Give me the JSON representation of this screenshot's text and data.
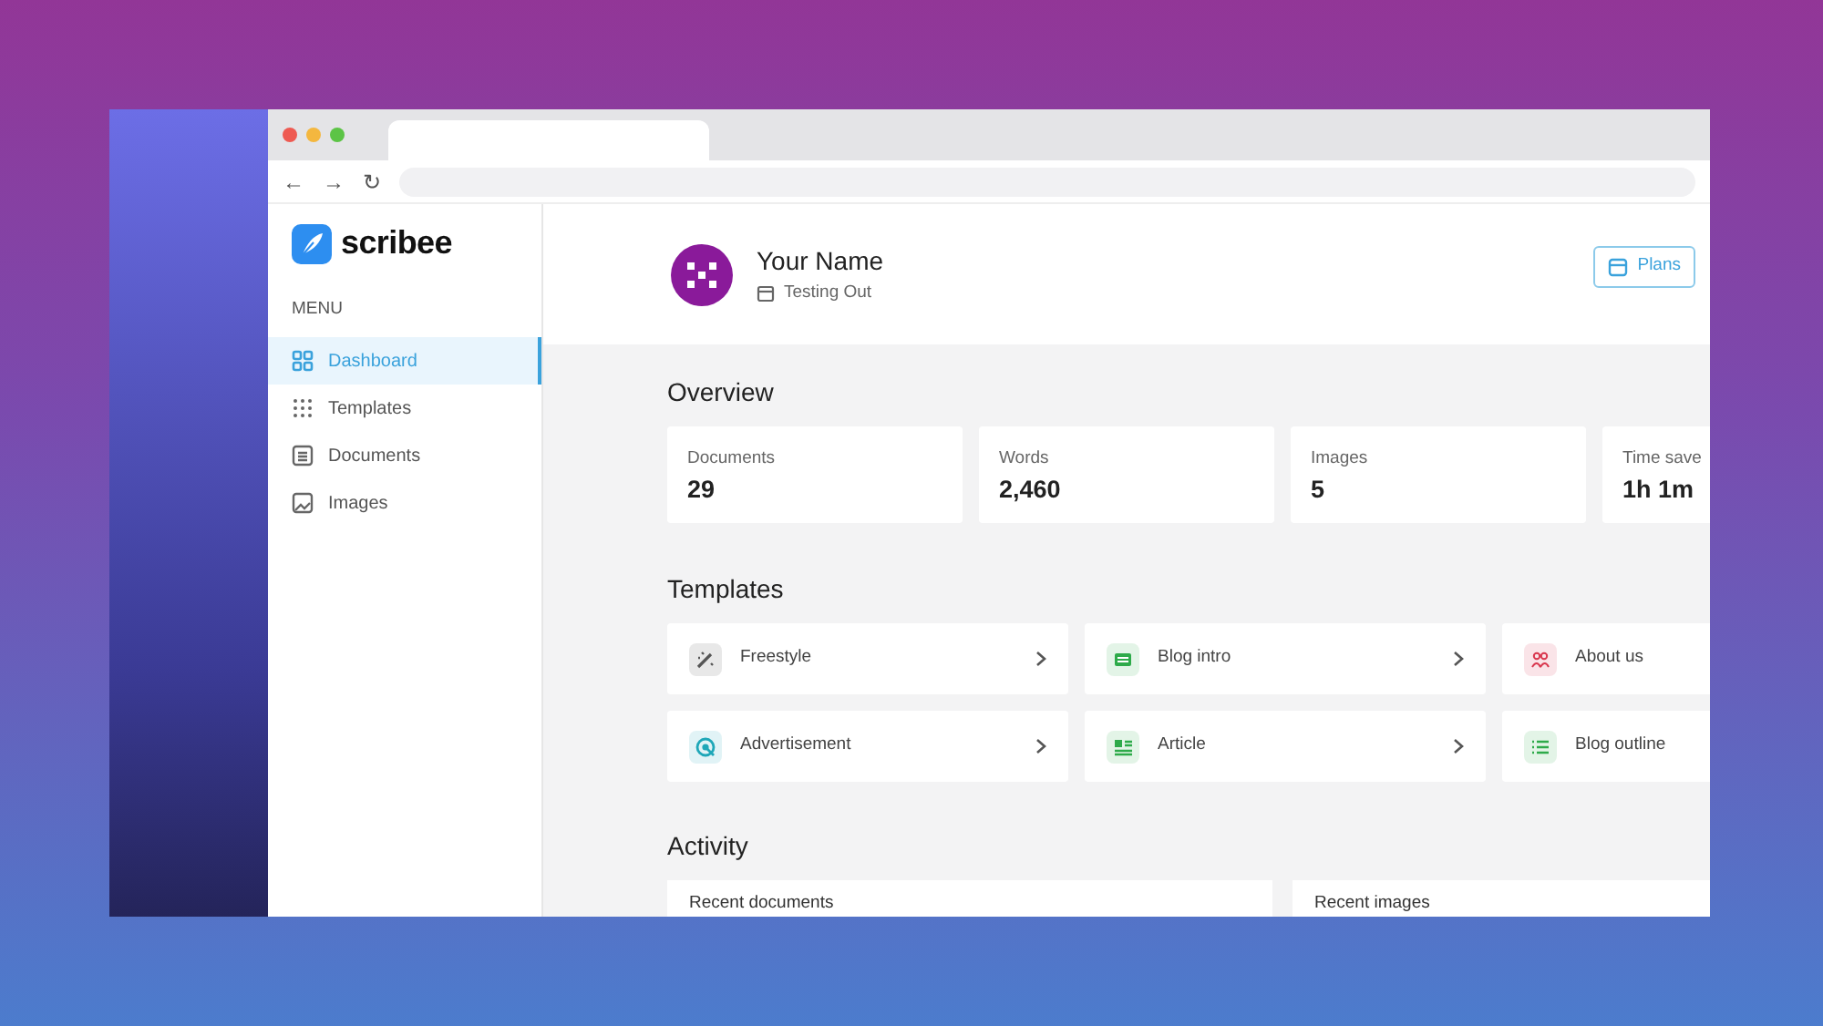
{
  "browser": {
    "nav_buttons": [
      "←",
      "→",
      "↻"
    ]
  },
  "sidebar": {
    "logo": "scribee",
    "menu_label": "MENU",
    "items": [
      {
        "label": "Dashboard",
        "kind": "grid4",
        "selected": true
      },
      {
        "label": "Templates",
        "kind": "grid9",
        "selected": false
      },
      {
        "label": "Documents",
        "kind": "doc",
        "selected": false
      },
      {
        "label": "Images",
        "kind": "image",
        "selected": false
      }
    ]
  },
  "header": {
    "name": "Your Name",
    "subtitle": "Testing Out",
    "plans_button": "Plans"
  },
  "overview": {
    "title": "Overview",
    "stats": [
      {
        "label": "Documents",
        "value": "29"
      },
      {
        "label": "Words",
        "value": "2,460"
      },
      {
        "label": "Images",
        "value": "5"
      },
      {
        "label": "Time save",
        "value": "1h 1m"
      }
    ]
  },
  "templates": {
    "title": "Templates",
    "items": [
      {
        "label": "Freestyle",
        "kind": "wand",
        "color": "#555555",
        "chevron": true
      },
      {
        "label": "Blog intro",
        "kind": "card",
        "color": "#2eaa4a",
        "chevron": true
      },
      {
        "label": "About us",
        "kind": "people",
        "color": "#d9384f",
        "chevron": false
      },
      {
        "label": "Advertisement",
        "kind": "target",
        "color": "#1fa7b8",
        "chevron": true
      },
      {
        "label": "Article",
        "kind": "article",
        "color": "#2eaa4a",
        "chevron": true
      },
      {
        "label": "Blog outline",
        "kind": "list",
        "color": "#2eaa4a",
        "chevron": false
      }
    ]
  },
  "activity": {
    "title": "Activity",
    "cards": [
      "Recent documents",
      "Recent images"
    ]
  }
}
